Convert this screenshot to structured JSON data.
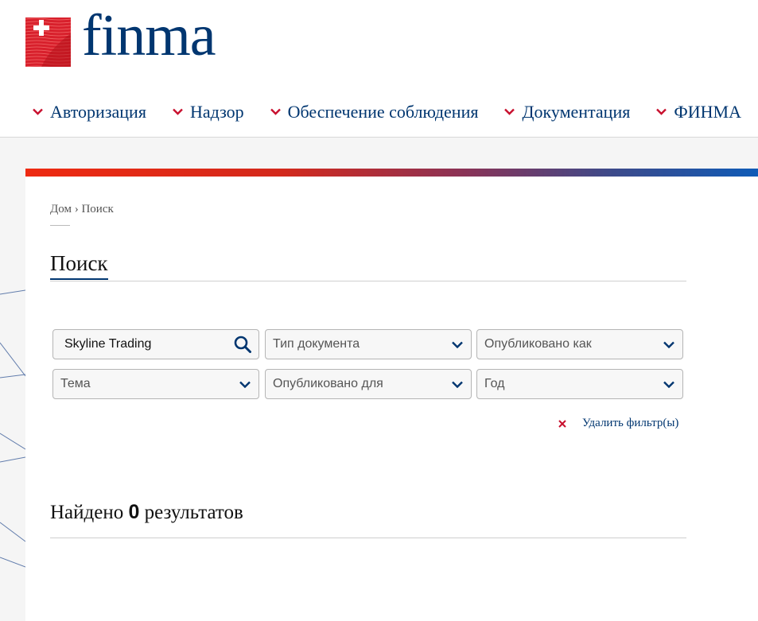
{
  "brand": {
    "name": "finma",
    "colors": {
      "primary": "#003670",
      "accent_red": "#c8102e",
      "gradient_start": "#ee2a11",
      "gradient_end": "#0f5bb7"
    }
  },
  "nav": {
    "items": [
      {
        "label": "Авторизация",
        "icon": "chevron-down-icon"
      },
      {
        "label": "Надзор",
        "icon": "chevron-down-icon"
      },
      {
        "label": "Обеспечение соблюдения",
        "icon": "chevron-down-icon"
      },
      {
        "label": "Документация",
        "icon": "chevron-down-icon"
      },
      {
        "label": "ФИНМА",
        "icon": "chevron-down-icon"
      }
    ]
  },
  "breadcrumb": {
    "home": "Дом",
    "separator": "›",
    "current": "Поиск"
  },
  "page": {
    "title": "Поиск"
  },
  "search": {
    "value": "Skyline Trading",
    "icon": "search-icon"
  },
  "filters": {
    "doc_type": "Тип документа",
    "published_as": "Опубликовано как",
    "topic": "Тема",
    "published_for": "Опубликовано для",
    "year": "Год"
  },
  "clear_filter": {
    "label": "Удалить фильтр(ы)",
    "icon": "close-icon"
  },
  "results": {
    "prefix": "Найдено",
    "count": "0",
    "suffix": "результатов"
  }
}
